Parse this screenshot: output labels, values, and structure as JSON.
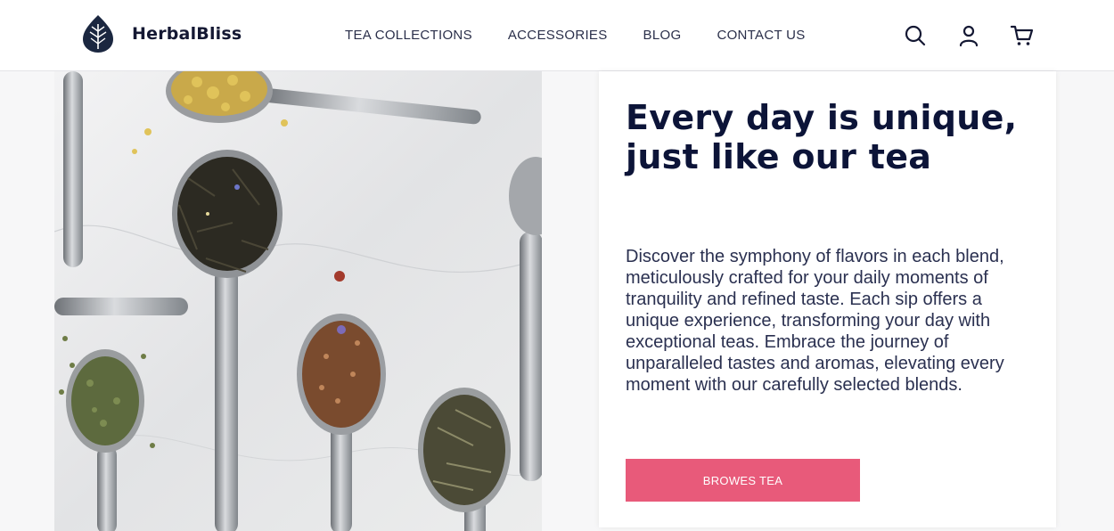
{
  "brand": {
    "name": "HerbalBliss",
    "logo_icon": "leaf-logo-icon"
  },
  "nav": {
    "items": [
      {
        "label": "TEA COLLECTIONS"
      },
      {
        "label": "ACCESSORIES"
      },
      {
        "label": "BLOG"
      },
      {
        "label": "CONTACT US"
      }
    ]
  },
  "header_icons": [
    "search-icon",
    "user-icon",
    "cart-icon"
  ],
  "hero": {
    "image_icon": "tea-spoons-photo",
    "title": "Every day is unique, just like our tea",
    "body": "Discover the symphony of flavors in each blend, meticulously crafted for your daily moments of tranquility and refined taste. Each sip offers a unique experience, transforming your day with exceptional teas. Embrace the journey of unparalleled tastes and aromas, elevating every moment with our carefully selected blends.",
    "cta_label": "BROWES TEA"
  },
  "colors": {
    "accent": "#e85a7a",
    "heading": "#0c1438",
    "logo": "#1b2740"
  }
}
